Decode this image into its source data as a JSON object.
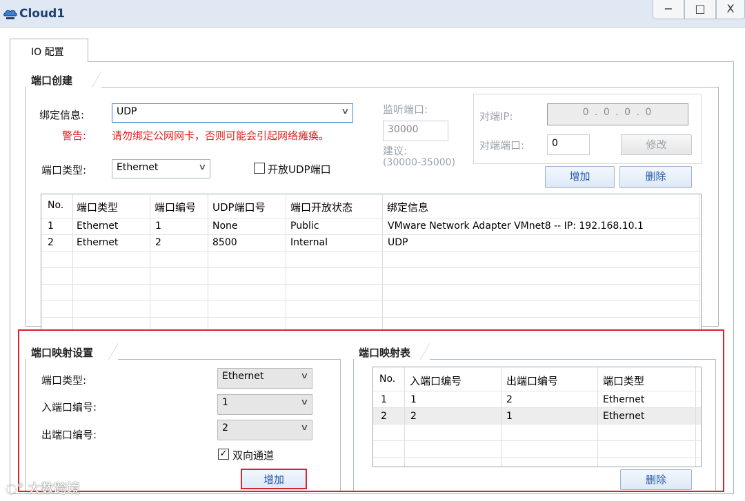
{
  "window": {
    "title": "Cloud1",
    "icon": "cloud-network-icon",
    "controls": {
      "minimize": "−",
      "maximize": "□",
      "close": "X"
    }
  },
  "tabs": [
    {
      "label": "IO 配置",
      "selected": true
    }
  ],
  "port_create": {
    "group_title": "端口创建",
    "bind_label": "绑定信息:",
    "bind_value": "UDP",
    "warning_label": "警告:",
    "warning_text": "请勿绑定公网网卡，否则可能会引起网络瘫痪。",
    "port_type_label": "端口类型:",
    "port_type_value": "Ethernet",
    "open_udp_label": "开放UDP端口",
    "open_udp_checked": false,
    "listen_port_label": "监听端口:",
    "listen_port_value": "30000",
    "suggest_label": "建议:",
    "suggest_range": "(30000-35000)",
    "peer_ip_label": "对端IP:",
    "peer_ip_value": "0 . 0 . 0 . 0",
    "peer_port_label": "对端端口:",
    "peer_port_value": "0",
    "modify_button": "修改",
    "add_button": "增加",
    "delete_button": "删除"
  },
  "port_table": {
    "headers": [
      "No.",
      "端口类型",
      "端口编号",
      "UDP端口号",
      "端口开放状态",
      "绑定信息"
    ],
    "rows": [
      [
        "1",
        "Ethernet",
        "1",
        "None",
        "Public",
        "VMware Network Adapter VMnet8 -- IP: 192.168.10.1"
      ],
      [
        "2",
        "Ethernet",
        "2",
        "8500",
        "Internal",
        "UDP"
      ]
    ]
  },
  "mapping_settings": {
    "group_title": "端口映射设置",
    "port_type_label": "端口类型:",
    "port_type_value": "Ethernet",
    "in_port_label": "入端口编号:",
    "in_port_value": "1",
    "out_port_label": "出端口编号:",
    "out_port_value": "2",
    "bidirectional_label": "双向通道",
    "bidirectional_checked": true,
    "add_button": "增加"
  },
  "mapping_table": {
    "group_title": "端口映射表",
    "headers": [
      "No.",
      "入端口编号",
      "出端口编号",
      "端口类型"
    ],
    "rows": [
      [
        "1",
        "1",
        "2",
        "Ethernet"
      ],
      [
        "2",
        "2",
        "1",
        "Ethernet"
      ]
    ],
    "delete_button": "删除"
  },
  "watermark": "大数跨境",
  "colors": {
    "titlebar": "#dfe8f3",
    "title_text": "#1e3f73",
    "warning": "#e02020",
    "highlight": "#d8232a",
    "button_text": "#2459a8"
  }
}
